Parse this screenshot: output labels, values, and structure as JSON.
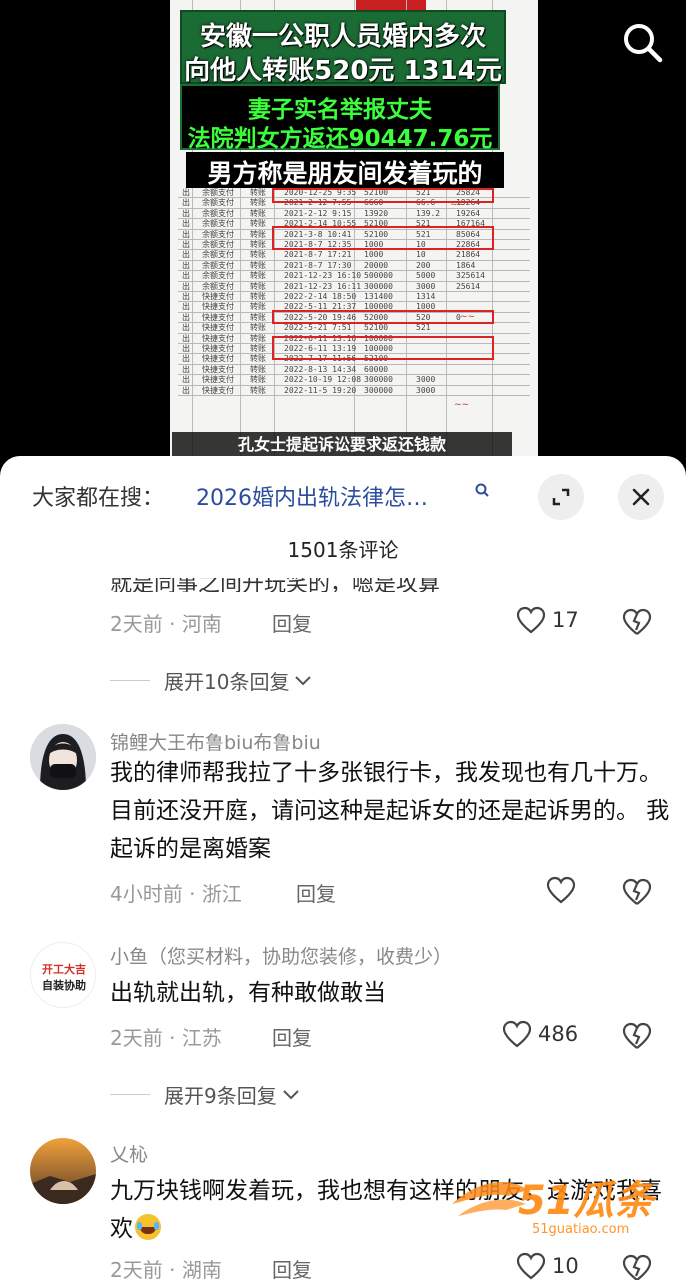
{
  "video": {
    "title_line1": "安徽一公职人员婚内多次",
    "title_line2": "向他人转账520元 1314元",
    "highlight_line1": "妻子实名举报丈夫",
    "highlight_line2": "法院判女方返还90447.76元",
    "subtitle": "男方称是朋友间发着玩的",
    "caption": "孔女士提起诉讼要求返还钱款",
    "search_icon": "search-icon",
    "statement_rows": [
      {
        "dir": "出",
        "method": "余额支付",
        "type": "转账",
        "time": "2020-12-25 9:35",
        "amount": "52100",
        "unit": "521",
        "balance": "25824"
      },
      {
        "dir": "出",
        "method": "余额支付",
        "type": "转账",
        "time": "2021-2-12 7:55",
        "amount": "6660",
        "unit": "66.6",
        "balance": "19264"
      },
      {
        "dir": "出",
        "method": "余额支付",
        "type": "转账",
        "time": "2021-2-12 9:15",
        "amount": "13920",
        "unit": "139.2",
        "balance": "19264"
      },
      {
        "dir": "出",
        "method": "余额支付",
        "type": "转账",
        "time": "2021-2-14 10:55",
        "amount": "52100",
        "unit": "521",
        "balance": "167164"
      },
      {
        "dir": "出",
        "method": "余额支付",
        "type": "转账",
        "time": "2021-3-8 10:41",
        "amount": "52100",
        "unit": "521",
        "balance": "85064"
      },
      {
        "dir": "出",
        "method": "余额支付",
        "type": "转账",
        "time": "2021-8-7 12:35",
        "amount": "1000",
        "unit": "10",
        "balance": "22864"
      },
      {
        "dir": "出",
        "method": "余额支付",
        "type": "转账",
        "time": "2021-8-7 17:21",
        "amount": "1000",
        "unit": "10",
        "balance": "21864"
      },
      {
        "dir": "出",
        "method": "余额支付",
        "type": "转账",
        "time": "2021-8-7 17:30",
        "amount": "20000",
        "unit": "200",
        "balance": "1864"
      },
      {
        "dir": "出",
        "method": "余额支付",
        "type": "转账",
        "time": "2021-12-23 16:10",
        "amount": "500000",
        "unit": "5000",
        "balance": "325614"
      },
      {
        "dir": "出",
        "method": "余额支付",
        "type": "转账",
        "time": "2021-12-23 16:11",
        "amount": "300000",
        "unit": "3000",
        "balance": "25614"
      },
      {
        "dir": "出",
        "method": "快捷支付",
        "type": "转账",
        "time": "2022-2-14 18:50",
        "amount": "131400",
        "unit": "1314",
        "balance": ""
      },
      {
        "dir": "出",
        "method": "快捷支付",
        "type": "转账",
        "time": "2022-5-11 21:37",
        "amount": "100000",
        "unit": "1000",
        "balance": ""
      },
      {
        "dir": "出",
        "method": "快捷支付",
        "type": "转账",
        "time": "2022-5-20 19:46",
        "amount": "52000",
        "unit": "520",
        "balance": "0"
      },
      {
        "dir": "出",
        "method": "快捷支付",
        "type": "转账",
        "time": "2022-5-21 7:51",
        "amount": "52100",
        "unit": "521",
        "balance": ""
      },
      {
        "dir": "出",
        "method": "快捷支付",
        "type": "转账",
        "time": "2022-6-11 13:16",
        "amount": "100000",
        "unit": "",
        "balance": ""
      },
      {
        "dir": "出",
        "method": "快捷支付",
        "type": "转账",
        "time": "2022-6-11 13:19",
        "amount": "100000",
        "unit": "",
        "balance": ""
      },
      {
        "dir": "出",
        "method": "快捷支付",
        "type": "转账",
        "time": "2022-7-17 11:56",
        "amount": "52100",
        "unit": "",
        "balance": ""
      },
      {
        "dir": "出",
        "method": "快捷支付",
        "type": "转账",
        "time": "2022-8-13 14:34",
        "amount": "60000",
        "unit": "",
        "balance": ""
      },
      {
        "dir": "出",
        "method": "快捷支付",
        "type": "转账",
        "time": "2022-10-19 12:08",
        "amount": "300000",
        "unit": "3000",
        "balance": ""
      },
      {
        "dir": "出",
        "method": "快捷支付",
        "type": "转账",
        "time": "2022-11-5 19:20",
        "amount": "300000",
        "unit": "3000",
        "balance": ""
      }
    ]
  },
  "sheet": {
    "search_prefix": "大家都在搜：",
    "search_term": "2026婚内出轨法律怎…",
    "comment_count": "1501条评论",
    "expand_icon": "expand-icon",
    "close_icon": "close-icon"
  },
  "comments": [
    {
      "partial_text": "就是同事之间开玩笑的，嗯是攻算",
      "time": "2天前",
      "location": "河南",
      "reply": "回复",
      "likes": "17",
      "expand": "展开10条回复"
    },
    {
      "author": "锦鲤大王布鲁biu布鲁biu",
      "text": "我的律师帮我拉了十多张银行卡，我发现也有几十万。目前还没开庭，请问这种是起诉女的还是起诉男的。 我起诉的是离婚案",
      "time": "4小时前",
      "location": "浙江",
      "reply": "回复",
      "likes": ""
    },
    {
      "author": "小鱼（您买材料，协助您装修，收费少）",
      "avatar_text1": "开工大吉",
      "avatar_text2": "自装协助",
      "text": "出轨就出轨，有种敢做敢当",
      "time": "2天前",
      "location": "江苏",
      "reply": "回复",
      "likes": "486",
      "expand": "展开9条回复"
    },
    {
      "author": "乂杺",
      "text": "九万块钱啊发着玩，我也想有这样的朋友，这游戏我喜欢",
      "time": "2天前",
      "location": "湖南",
      "reply": "回复",
      "likes": "10"
    }
  ],
  "watermark": {
    "brand": "51瓜条",
    "url": "51guatiao.com"
  }
}
